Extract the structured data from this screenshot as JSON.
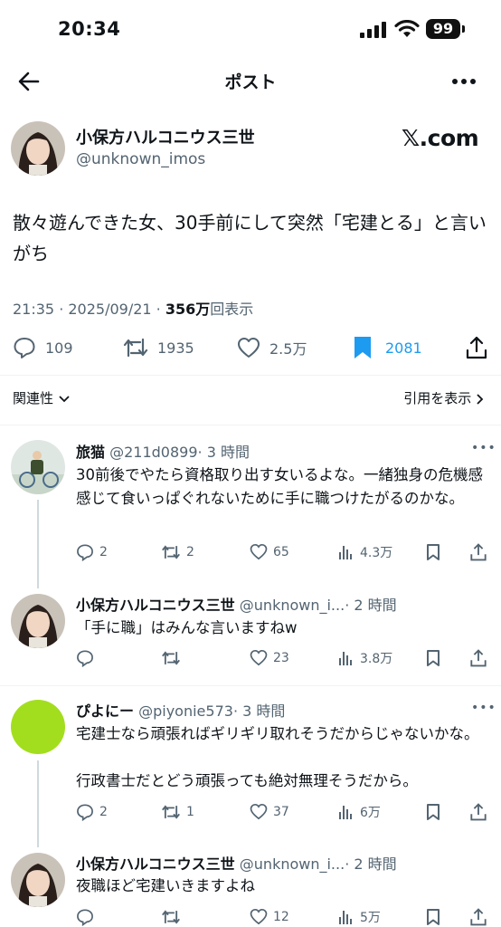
{
  "status": {
    "time": "20:34",
    "battery": "99"
  },
  "nav": {
    "title": "ポスト"
  },
  "post": {
    "name": "小保方ハルコニウス三世",
    "handle": "@unknown_imos",
    "brand": "𝕏.com",
    "text": "散々遊んできた女、30手前にして突然「宅建とる」と言いがち",
    "time": "21:35 · 2025/09/21 · ",
    "views": "356万",
    "views_label": "回表示",
    "replies": "109",
    "reposts": "1935",
    "likes": "2.5万",
    "bookmarks": "2081",
    "accent": "#1d9bf0"
  },
  "filters": {
    "related": "関連性",
    "quotes": "引用を表示"
  },
  "replies": [
    {
      "name": "旅猫",
      "handle": "@211d0899",
      "time": "· 3 時間",
      "text": "30前後でやたら資格取り出す女いるよな。一緒独身の危機感感じて食いっぱぐれないために手に職つけたがるのかな。",
      "replies": "2",
      "reposts": "2",
      "likes": "65",
      "views": "4.3万"
    },
    {
      "name": "小保方ハルコニウス三世",
      "handle": "@unknown_i...",
      "time": "· 2 時間",
      "text": "「手に職」はみんな言いますねw",
      "replies": "",
      "reposts": "",
      "likes": "23",
      "views": "3.8万"
    },
    {
      "name": "ぴよにー",
      "handle": "@piyonie573",
      "time": "· 3 時間",
      "text": "宅建士なら頑張ればギリギリ取れそうだからじゃないかな。",
      "text2": "行政書士だとどう頑張っても絶対無理そうだから。",
      "replies": "2",
      "reposts": "1",
      "likes": "37",
      "views": "6万"
    },
    {
      "name": "小保方ハルコニウス三世",
      "handle": "@unknown_i...",
      "time": "· 2 時間",
      "text": "夜職ほど宅建いきますよね",
      "replies": "",
      "reposts": "",
      "likes": "12",
      "views": "5万"
    }
  ]
}
